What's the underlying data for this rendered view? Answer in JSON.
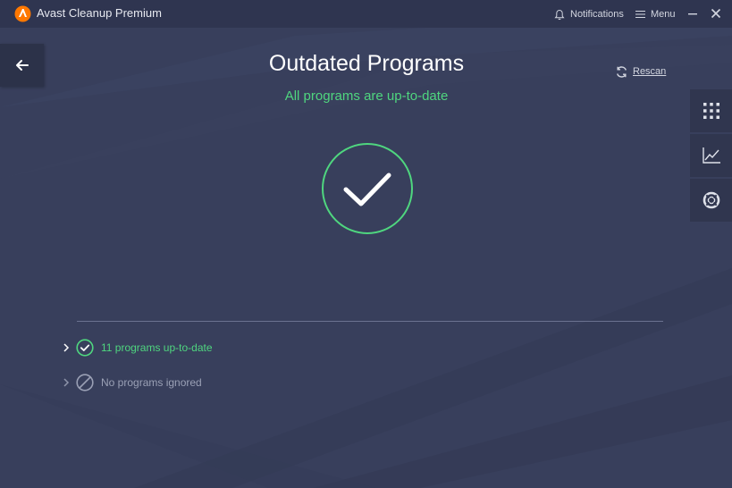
{
  "app": {
    "title": "Avast Cleanup Premium"
  },
  "titlebar": {
    "notifications_label": "Notifications",
    "menu_label": "Menu"
  },
  "main": {
    "title": "Outdated Programs",
    "status": "All programs are up-to-date",
    "rescan_label": "Rescan"
  },
  "sections": [
    {
      "label": "11 programs up-to-date",
      "icon": "check-circle-icon",
      "color": "#4fd67f"
    },
    {
      "label": "No programs ignored",
      "icon": "blocked-icon",
      "color": "#9aa0b5"
    }
  ],
  "side_panel": [
    "grid-icon",
    "chart-icon",
    "lifebuoy-icon"
  ],
  "colors": {
    "accent": "#4fd67f",
    "background": "#383f5c",
    "brand": "#ff7800"
  }
}
